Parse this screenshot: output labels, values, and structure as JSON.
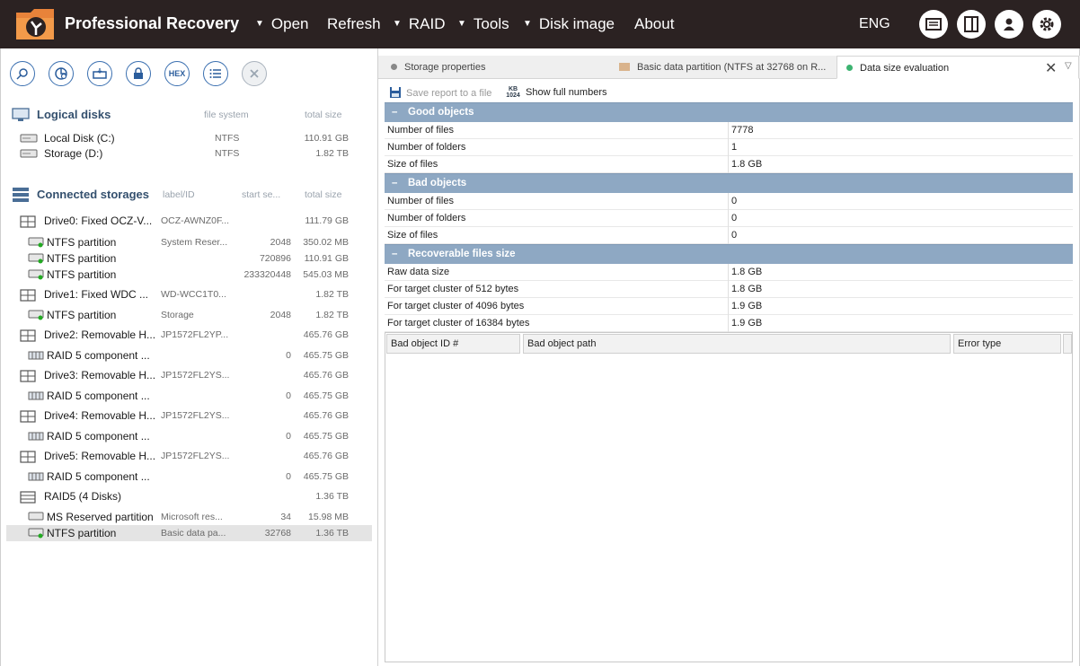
{
  "app": {
    "title": "Professional Recovery",
    "language": "ENG"
  },
  "menu": [
    {
      "label": "Open",
      "has_dropdown": true
    },
    {
      "label": "Refresh",
      "has_dropdown": false
    },
    {
      "label": "RAID",
      "has_dropdown": true
    },
    {
      "label": "Tools",
      "has_dropdown": true
    },
    {
      "label": "Disk image",
      "has_dropdown": true
    },
    {
      "label": "About",
      "has_dropdown": false
    }
  ],
  "toolbar": {
    "hex_label": "HEX"
  },
  "logical_disks": {
    "title": "Logical disks",
    "col_fs": "file system",
    "col_size": "total size",
    "items": [
      {
        "name": "Local Disk (C:)",
        "fs": "NTFS",
        "size": "110.91 GB"
      },
      {
        "name": "Storage (D:)",
        "fs": "NTFS",
        "size": "1.82 TB"
      }
    ]
  },
  "storages": {
    "title": "Connected storages",
    "col_label": "label/ID",
    "col_start": "start se...",
    "col_size": "total size",
    "items": [
      {
        "name": "Drive0: Fixed OCZ-V...",
        "label": "OCZ-AWNZ0F...",
        "start": "",
        "size": "111.79 GB",
        "kind": "drive"
      },
      {
        "name": "NTFS partition",
        "label": "System Reser...",
        "start": "2048",
        "size": "350.02 MB",
        "kind": "partition"
      },
      {
        "name": "NTFS partition",
        "label": "",
        "start": "720896",
        "size": "110.91 GB",
        "kind": "partition"
      },
      {
        "name": "NTFS partition",
        "label": "",
        "start": "233320448",
        "size": "545.03 MB",
        "kind": "partition"
      },
      {
        "name": "Drive1: Fixed WDC ...",
        "label": "WD-WCC1T0...",
        "start": "",
        "size": "1.82 TB",
        "kind": "drive"
      },
      {
        "name": "NTFS partition",
        "label": "Storage",
        "start": "2048",
        "size": "1.82 TB",
        "kind": "partition"
      },
      {
        "name": "Drive2: Removable H...",
        "label": "JP1572FL2YP...",
        "start": "",
        "size": "465.76 GB",
        "kind": "drive"
      },
      {
        "name": "RAID 5 component ...",
        "label": "",
        "start": "0",
        "size": "465.75 GB",
        "kind": "raidcomp"
      },
      {
        "name": "Drive3: Removable H...",
        "label": "JP1572FL2YS...",
        "start": "",
        "size": "465.76 GB",
        "kind": "drive"
      },
      {
        "name": "RAID 5 component ...",
        "label": "",
        "start": "0",
        "size": "465.75 GB",
        "kind": "raidcomp"
      },
      {
        "name": "Drive4: Removable H...",
        "label": "JP1572FL2YS...",
        "start": "",
        "size": "465.76 GB",
        "kind": "drive"
      },
      {
        "name": "RAID 5 component ...",
        "label": "",
        "start": "0",
        "size": "465.75 GB",
        "kind": "raidcomp"
      },
      {
        "name": "Drive5: Removable H...",
        "label": "JP1572FL2YS...",
        "start": "",
        "size": "465.76 GB",
        "kind": "drive"
      },
      {
        "name": "RAID 5 component ...",
        "label": "",
        "start": "0",
        "size": "465.75 GB",
        "kind": "raidcomp"
      },
      {
        "name": "RAID5 (4 Disks)",
        "label": "",
        "start": "",
        "size": "1.36 TB",
        "kind": "raid"
      },
      {
        "name": "MS Reserved partition",
        "label": "Microsoft res...",
        "start": "34",
        "size": "15.98 MB",
        "kind": "partition-gray"
      },
      {
        "name": "NTFS partition",
        "label": "Basic data pa...",
        "start": "32768",
        "size": "1.36 TB",
        "kind": "partition",
        "selected": true
      }
    ]
  },
  "tabs": [
    {
      "label": "Storage properties",
      "active": false
    },
    {
      "label": "Basic data partition (NTFS at 32768 on R...",
      "active": false
    },
    {
      "label": "Data size evaluation",
      "active": true
    }
  ],
  "actions": {
    "save_report": "Save report to a file",
    "show_full_numbers": "Show full numbers",
    "kb_top": "KB",
    "kb_bottom": "1024"
  },
  "evaluation": {
    "good": {
      "title": "Good objects",
      "rows": [
        {
          "k": "Number of files",
          "v": "7778"
        },
        {
          "k": "Number of folders",
          "v": "1"
        },
        {
          "k": "Size of files",
          "v": "1.8 GB"
        }
      ]
    },
    "bad": {
      "title": "Bad objects",
      "rows": [
        {
          "k": "Number of files",
          "v": "0"
        },
        {
          "k": "Number of folders",
          "v": "0"
        },
        {
          "k": "Size of files",
          "v": "0"
        }
      ]
    },
    "recoverable": {
      "title": "Recoverable files size",
      "rows": [
        {
          "k": "Raw data size",
          "v": "1.8 GB"
        },
        {
          "k": "For target cluster of 512 bytes",
          "v": "1.8 GB"
        },
        {
          "k": "For target cluster of 4096 bytes",
          "v": "1.9 GB"
        },
        {
          "k": "For target cluster of 16384 bytes",
          "v": "1.9 GB"
        }
      ]
    }
  },
  "bad_table": {
    "col_id": "Bad object ID #",
    "col_path": "Bad object path",
    "col_error": "Error type"
  },
  "colors": {
    "topbar": "#2b2222",
    "group_header": "#8ea8c3",
    "active_tab_dot": "#3cb371",
    "inactive_tab_dot": "#888888",
    "partition_dot": "#22aa22"
  }
}
